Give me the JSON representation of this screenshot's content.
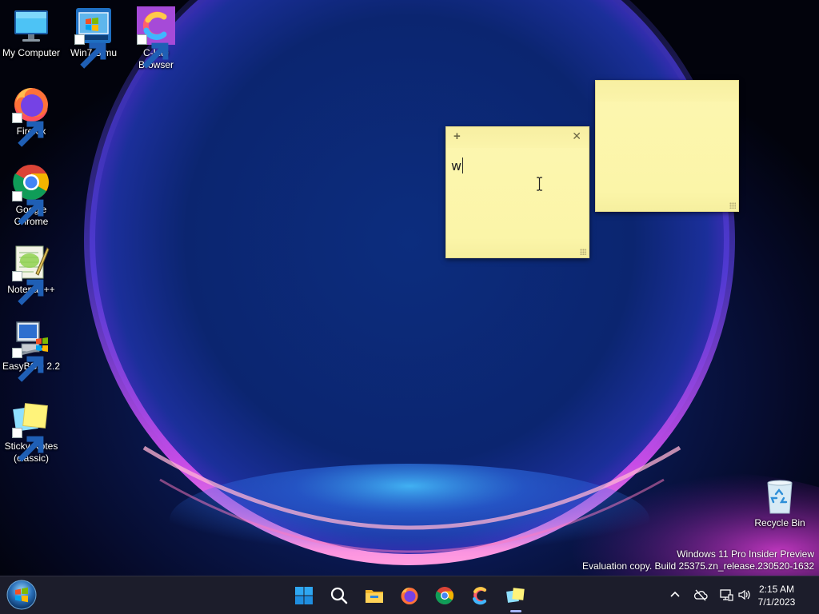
{
  "desktop_icons": [
    {
      "label": "My Computer",
      "icon": "monitor-icon"
    },
    {
      "label": "Win7 Simu",
      "icon": "win7-simu-icon"
    },
    {
      "label": "C-Lite Browser",
      "icon": "clite-browser-icon"
    },
    {
      "label": "Firefox",
      "icon": "firefox-icon"
    },
    {
      "label": "Google Chrome",
      "icon": "chrome-icon"
    },
    {
      "label": "Notepad++",
      "icon": "notepadpp-icon"
    },
    {
      "label": "EasyBCD 2.2",
      "icon": "easybcd-icon"
    },
    {
      "label": "Sticky Notes (classic)",
      "icon": "sticky-notes-icon"
    },
    {
      "label": "Recycle Bin",
      "icon": "recycle-bin-icon"
    }
  ],
  "sticky_notes": [
    {
      "text": "w",
      "focused": true
    },
    {
      "text": "",
      "focused": false
    }
  ],
  "note_controls": {
    "add": "+",
    "close": "✕"
  },
  "watermark": {
    "line1": "Windows 11 Pro Insider Preview",
    "line2": "Evaluation copy. Build 25375.zn_release.230520-1632"
  },
  "taskbar": {
    "apps": [
      "start-icon",
      "search-icon",
      "file-explorer-icon",
      "firefox-icon",
      "chrome-icon",
      "clite-browser-icon",
      "sticky-notes-icon"
    ],
    "active_app": "sticky-notes-icon"
  },
  "tray": {
    "icons": [
      "chevron-up-icon",
      "onedrive-offline-icon",
      "network-icon",
      "volume-icon"
    ],
    "time": "2:15 AM",
    "date": "7/1/2023"
  },
  "colors": {
    "note_yellow": "#fbf5a8",
    "taskbar": "#1c1d2b"
  }
}
